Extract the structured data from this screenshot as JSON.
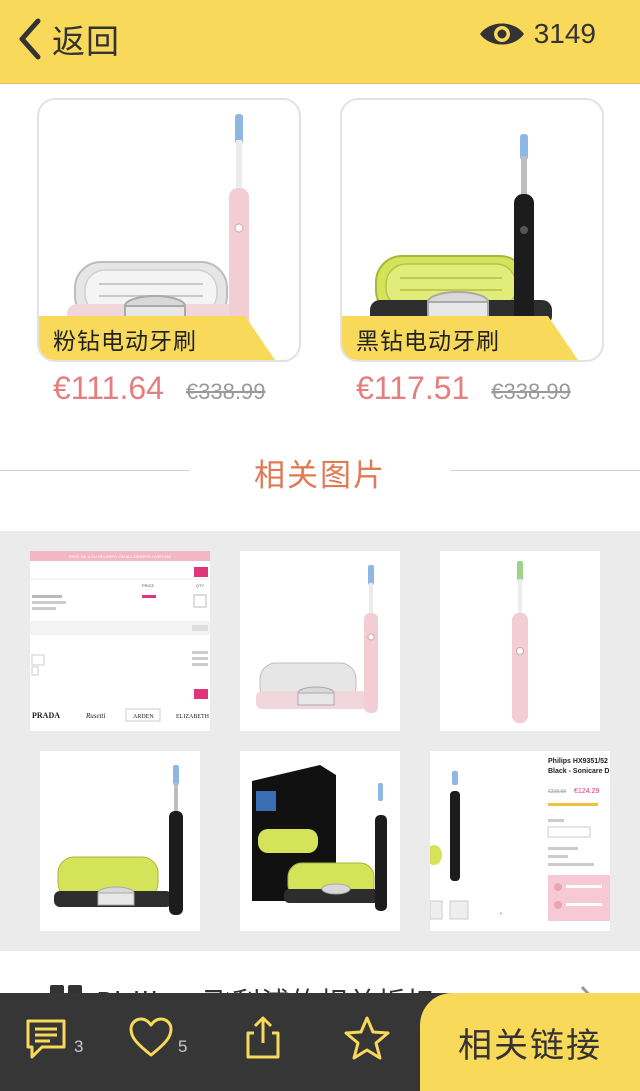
{
  "header": {
    "back_label": "返回",
    "view_count": "3149"
  },
  "products": [
    {
      "name": "粉钻电动牙刷",
      "price": "€111.64",
      "old_price": "€338.99",
      "handle_color": "#f3cdd4",
      "dock_color": "#e9b9c4"
    },
    {
      "name": "黑钻电动牙刷",
      "price": "€117.51",
      "old_price": "€338.99",
      "handle_color": "#1c1c1c",
      "dock_color": "#2d2d2d"
    }
  ],
  "section": {
    "title": "相关图片"
  },
  "gallery": {
    "thumb_texts": {
      "shop_banner": "FREE UK & EU DELIVERY ON ALL ORDERS OVER £60",
      "price_col": "PRICE",
      "qty_col": "QTY",
      "brands": [
        "PRADA",
        "Rusetti",
        "ARDEN",
        "ELIZABETH"
      ],
      "product_title_1": "Philips HX9351/52",
      "product_title_2": "Black - Sonicare D",
      "old_price": "€338.99",
      "new_price": "€124.29"
    }
  },
  "article": {
    "title": "Philips 飞利浦的相关折扣"
  },
  "bottom": {
    "comment_count": "3",
    "like_count": "5",
    "related_label": "相关链接"
  },
  "colors": {
    "accent_yellow": "#f8d95a",
    "price_red": "#e57f7f",
    "section_orange": "#e07a55",
    "bar_dark": "#363636"
  }
}
